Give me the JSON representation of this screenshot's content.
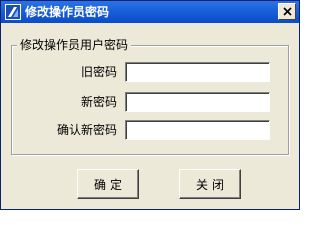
{
  "window": {
    "title": "修改操作员密码",
    "close_symbol": "×"
  },
  "group": {
    "title": "修改操作员用户密码"
  },
  "fields": {
    "old_password": {
      "label": "旧密码",
      "value": ""
    },
    "new_password": {
      "label": "新密码",
      "value": ""
    },
    "confirm_password": {
      "label": "确认新密码",
      "value": ""
    }
  },
  "buttons": {
    "ok_label": "确定",
    "close_label": "关闭"
  },
  "colors": {
    "titlebar": "#1a5fd9",
    "window_bg": "#ece9d8"
  },
  "icons": {
    "app": "app-logo-icon",
    "close": "close-icon"
  }
}
